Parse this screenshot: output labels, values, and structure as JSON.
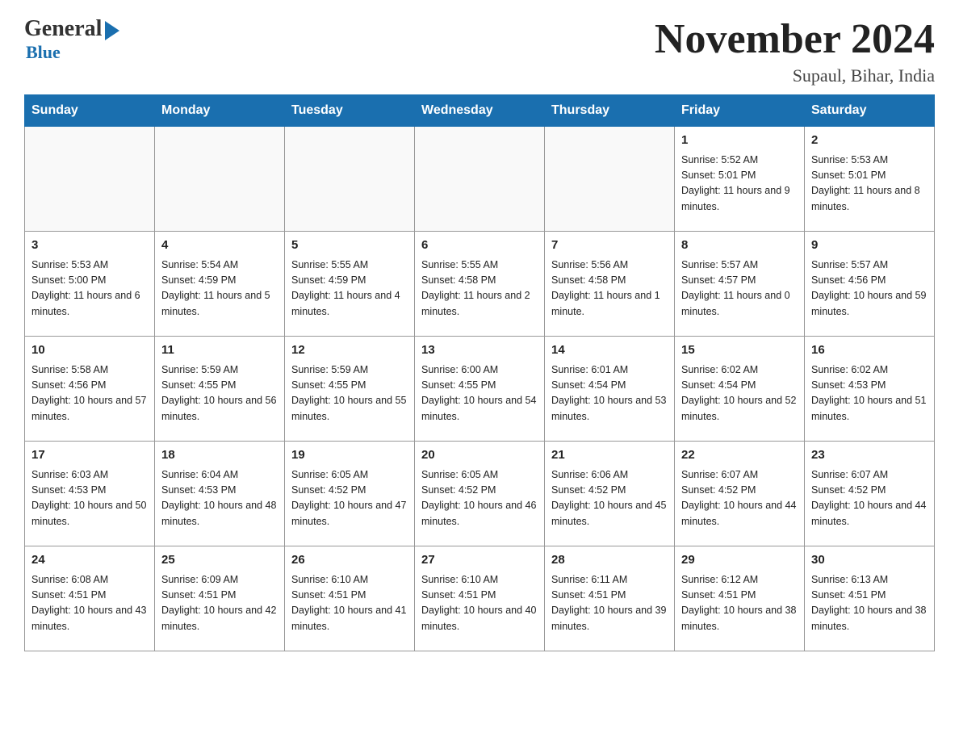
{
  "logo": {
    "general": "General",
    "blue": "Blue"
  },
  "title": "November 2024",
  "location": "Supaul, Bihar, India",
  "days_of_week": [
    "Sunday",
    "Monday",
    "Tuesday",
    "Wednesday",
    "Thursday",
    "Friday",
    "Saturday"
  ],
  "weeks": [
    [
      {
        "day": "",
        "info": ""
      },
      {
        "day": "",
        "info": ""
      },
      {
        "day": "",
        "info": ""
      },
      {
        "day": "",
        "info": ""
      },
      {
        "day": "",
        "info": ""
      },
      {
        "day": "1",
        "info": "Sunrise: 5:52 AM\nSunset: 5:01 PM\nDaylight: 11 hours and 9 minutes."
      },
      {
        "day": "2",
        "info": "Sunrise: 5:53 AM\nSunset: 5:01 PM\nDaylight: 11 hours and 8 minutes."
      }
    ],
    [
      {
        "day": "3",
        "info": "Sunrise: 5:53 AM\nSunset: 5:00 PM\nDaylight: 11 hours and 6 minutes."
      },
      {
        "day": "4",
        "info": "Sunrise: 5:54 AM\nSunset: 4:59 PM\nDaylight: 11 hours and 5 minutes."
      },
      {
        "day": "5",
        "info": "Sunrise: 5:55 AM\nSunset: 4:59 PM\nDaylight: 11 hours and 4 minutes."
      },
      {
        "day": "6",
        "info": "Sunrise: 5:55 AM\nSunset: 4:58 PM\nDaylight: 11 hours and 2 minutes."
      },
      {
        "day": "7",
        "info": "Sunrise: 5:56 AM\nSunset: 4:58 PM\nDaylight: 11 hours and 1 minute."
      },
      {
        "day": "8",
        "info": "Sunrise: 5:57 AM\nSunset: 4:57 PM\nDaylight: 11 hours and 0 minutes."
      },
      {
        "day": "9",
        "info": "Sunrise: 5:57 AM\nSunset: 4:56 PM\nDaylight: 10 hours and 59 minutes."
      }
    ],
    [
      {
        "day": "10",
        "info": "Sunrise: 5:58 AM\nSunset: 4:56 PM\nDaylight: 10 hours and 57 minutes."
      },
      {
        "day": "11",
        "info": "Sunrise: 5:59 AM\nSunset: 4:55 PM\nDaylight: 10 hours and 56 minutes."
      },
      {
        "day": "12",
        "info": "Sunrise: 5:59 AM\nSunset: 4:55 PM\nDaylight: 10 hours and 55 minutes."
      },
      {
        "day": "13",
        "info": "Sunrise: 6:00 AM\nSunset: 4:55 PM\nDaylight: 10 hours and 54 minutes."
      },
      {
        "day": "14",
        "info": "Sunrise: 6:01 AM\nSunset: 4:54 PM\nDaylight: 10 hours and 53 minutes."
      },
      {
        "day": "15",
        "info": "Sunrise: 6:02 AM\nSunset: 4:54 PM\nDaylight: 10 hours and 52 minutes."
      },
      {
        "day": "16",
        "info": "Sunrise: 6:02 AM\nSunset: 4:53 PM\nDaylight: 10 hours and 51 minutes."
      }
    ],
    [
      {
        "day": "17",
        "info": "Sunrise: 6:03 AM\nSunset: 4:53 PM\nDaylight: 10 hours and 50 minutes."
      },
      {
        "day": "18",
        "info": "Sunrise: 6:04 AM\nSunset: 4:53 PM\nDaylight: 10 hours and 48 minutes."
      },
      {
        "day": "19",
        "info": "Sunrise: 6:05 AM\nSunset: 4:52 PM\nDaylight: 10 hours and 47 minutes."
      },
      {
        "day": "20",
        "info": "Sunrise: 6:05 AM\nSunset: 4:52 PM\nDaylight: 10 hours and 46 minutes."
      },
      {
        "day": "21",
        "info": "Sunrise: 6:06 AM\nSunset: 4:52 PM\nDaylight: 10 hours and 45 minutes."
      },
      {
        "day": "22",
        "info": "Sunrise: 6:07 AM\nSunset: 4:52 PM\nDaylight: 10 hours and 44 minutes."
      },
      {
        "day": "23",
        "info": "Sunrise: 6:07 AM\nSunset: 4:52 PM\nDaylight: 10 hours and 44 minutes."
      }
    ],
    [
      {
        "day": "24",
        "info": "Sunrise: 6:08 AM\nSunset: 4:51 PM\nDaylight: 10 hours and 43 minutes."
      },
      {
        "day": "25",
        "info": "Sunrise: 6:09 AM\nSunset: 4:51 PM\nDaylight: 10 hours and 42 minutes."
      },
      {
        "day": "26",
        "info": "Sunrise: 6:10 AM\nSunset: 4:51 PM\nDaylight: 10 hours and 41 minutes."
      },
      {
        "day": "27",
        "info": "Sunrise: 6:10 AM\nSunset: 4:51 PM\nDaylight: 10 hours and 40 minutes."
      },
      {
        "day": "28",
        "info": "Sunrise: 6:11 AM\nSunset: 4:51 PM\nDaylight: 10 hours and 39 minutes."
      },
      {
        "day": "29",
        "info": "Sunrise: 6:12 AM\nSunset: 4:51 PM\nDaylight: 10 hours and 38 minutes."
      },
      {
        "day": "30",
        "info": "Sunrise: 6:13 AM\nSunset: 4:51 PM\nDaylight: 10 hours and 38 minutes."
      }
    ]
  ]
}
